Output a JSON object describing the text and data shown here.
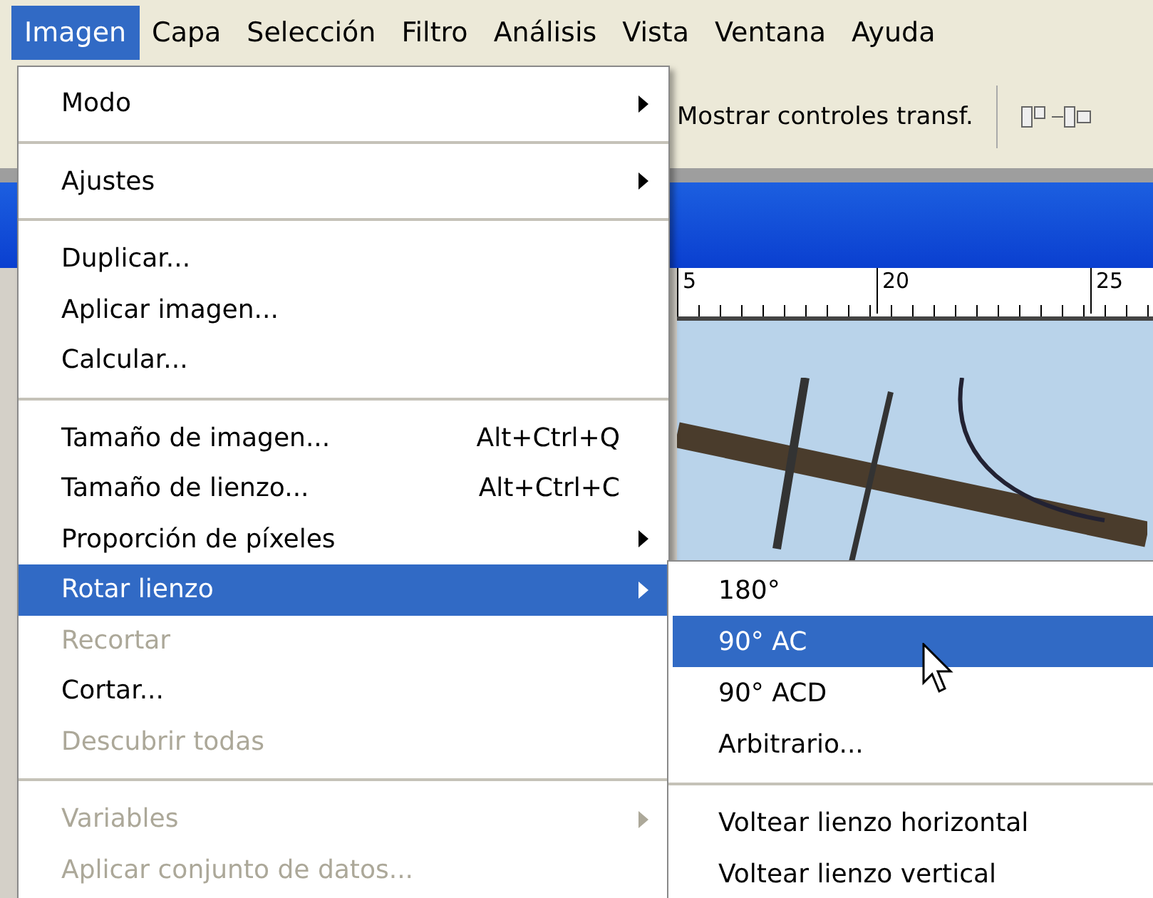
{
  "menubar": [
    {
      "label": "Imagen",
      "selected": true
    },
    {
      "label": "Capa",
      "selected": false
    },
    {
      "label": "Selección",
      "selected": false
    },
    {
      "label": "Filtro",
      "selected": false
    },
    {
      "label": "Análisis",
      "selected": false
    },
    {
      "label": "Vista",
      "selected": false
    },
    {
      "label": "Ventana",
      "selected": false
    },
    {
      "label": "Ayuda",
      "selected": false
    }
  ],
  "toolbar": {
    "label": "Mostrar controles transf."
  },
  "ruler": {
    "labels": [
      "5",
      "20",
      "25"
    ]
  },
  "menu": [
    {
      "kind": "item",
      "label": "Modo",
      "submenu": true,
      "disabled": false,
      "selected": false
    },
    {
      "kind": "separator"
    },
    {
      "kind": "item",
      "label": "Ajustes",
      "submenu": true,
      "disabled": false,
      "selected": false
    },
    {
      "kind": "separator"
    },
    {
      "kind": "item",
      "label": "Duplicar...",
      "disabled": false,
      "selected": false
    },
    {
      "kind": "item",
      "label": "Aplicar imagen...",
      "disabled": false,
      "selected": false
    },
    {
      "kind": "item",
      "label": "Calcular...",
      "disabled": false,
      "selected": false
    },
    {
      "kind": "separator"
    },
    {
      "kind": "item",
      "label": "Tamaño de imagen...",
      "shortcut": "Alt+Ctrl+Q",
      "disabled": false,
      "selected": false
    },
    {
      "kind": "item",
      "label": "Tamaño de lienzo...",
      "shortcut": "Alt+Ctrl+C",
      "disabled": false,
      "selected": false
    },
    {
      "kind": "item",
      "label": "Proporción de píxeles",
      "submenu": true,
      "disabled": false,
      "selected": false
    },
    {
      "kind": "item",
      "label": "Rotar lienzo",
      "submenu": true,
      "disabled": false,
      "selected": true
    },
    {
      "kind": "item",
      "label": "Recortar",
      "disabled": true,
      "selected": false
    },
    {
      "kind": "item",
      "label": "Cortar...",
      "disabled": false,
      "selected": false
    },
    {
      "kind": "item",
      "label": "Descubrir todas",
      "disabled": true,
      "selected": false
    },
    {
      "kind": "separator"
    },
    {
      "kind": "item",
      "label": "Variables",
      "submenu": true,
      "disabled": true,
      "selected": false
    },
    {
      "kind": "item",
      "label": "Aplicar conjunto de datos...",
      "disabled": true,
      "selected": false
    }
  ],
  "submenu": [
    {
      "kind": "item",
      "label": "180°",
      "selected": false
    },
    {
      "kind": "item",
      "label": "90° AC",
      "selected": true
    },
    {
      "kind": "item",
      "label": "90° ACD",
      "selected": false
    },
    {
      "kind": "item",
      "label": "Arbitrario...",
      "selected": false
    },
    {
      "kind": "separator"
    },
    {
      "kind": "item",
      "label": "Voltear lienzo horizontal",
      "selected": false
    },
    {
      "kind": "item",
      "label": "Voltear lienzo vertical",
      "selected": false
    }
  ]
}
